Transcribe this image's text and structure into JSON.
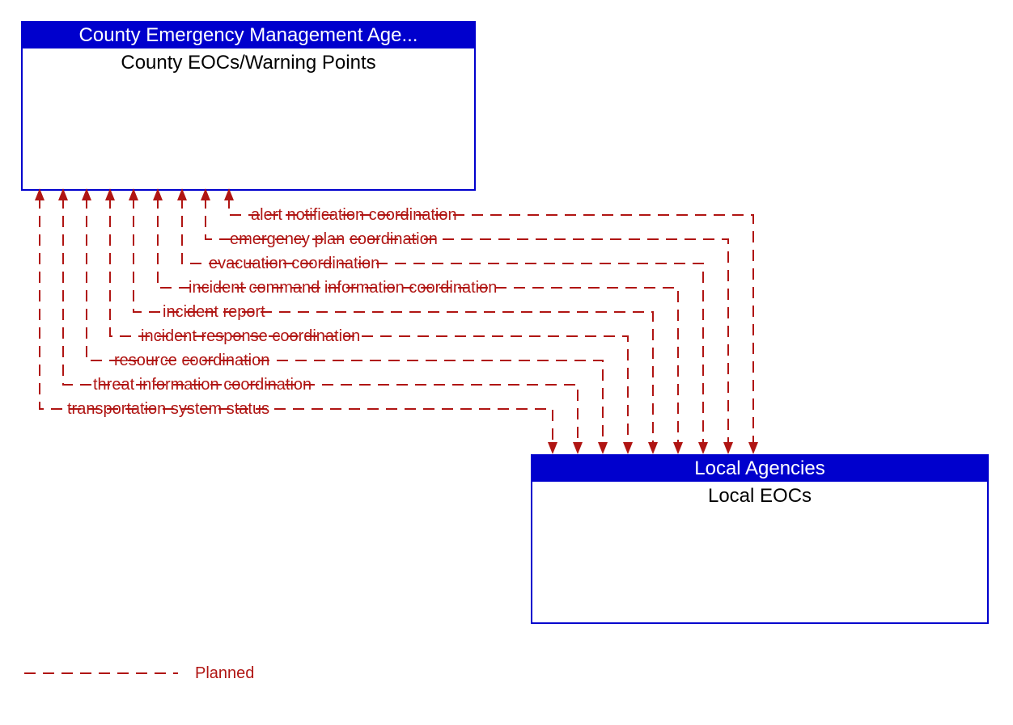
{
  "boxes": {
    "county": {
      "header": "County Emergency Management Age...",
      "title": "County EOCs/Warning Points"
    },
    "local": {
      "header": "Local Agencies",
      "title": "Local EOCs"
    }
  },
  "flows": [
    "alert notification coordination",
    "emergency plan coordination",
    "evacuation coordination",
    "incident command information coordination",
    "incident report",
    "incident response coordination",
    "resource coordination",
    "threat information coordination",
    "transportation system status"
  ],
  "legend": {
    "planned": "Planned"
  },
  "colors": {
    "header_bg": "#0000cd",
    "header_fg": "#ffffff",
    "flow": "#b01513",
    "text": "#000000"
  }
}
